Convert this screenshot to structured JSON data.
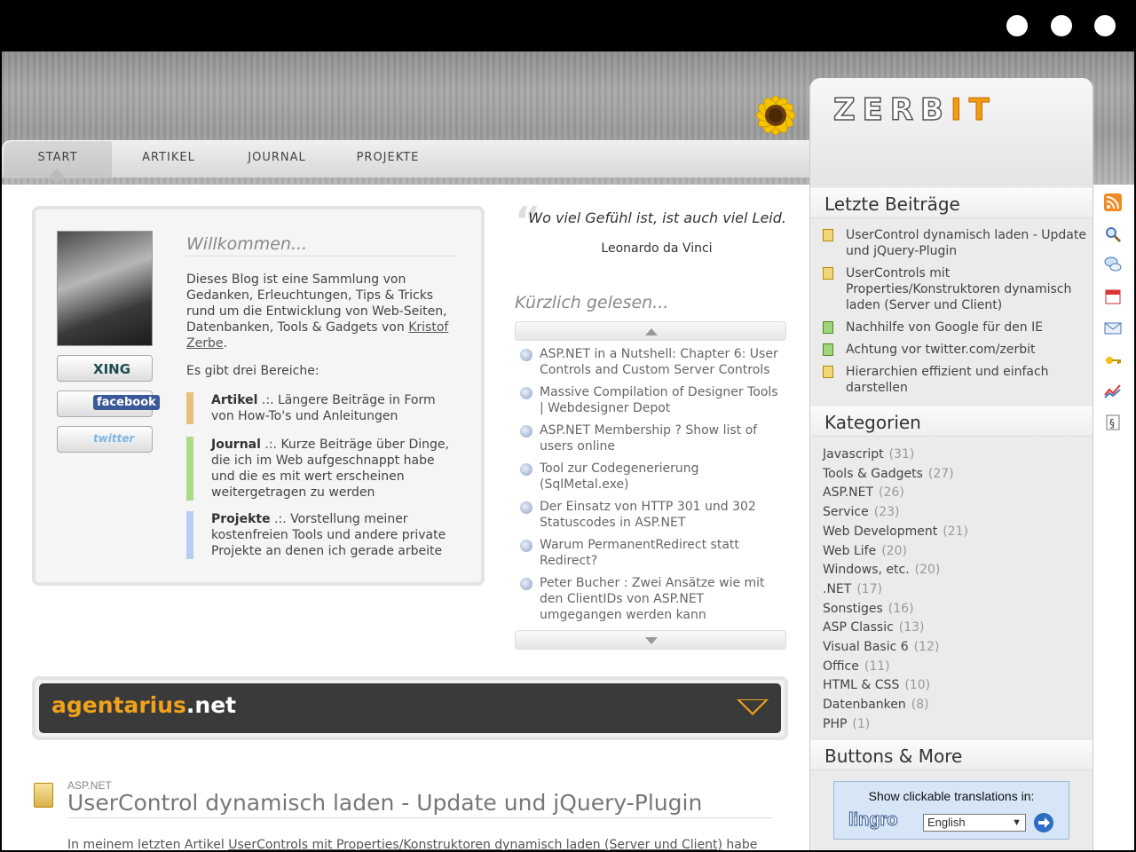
{
  "nav": {
    "items": [
      {
        "label": "Start",
        "active": true
      },
      {
        "label": "Artikel",
        "active": false
      },
      {
        "label": "Journal",
        "active": false
      },
      {
        "label": "Projekte",
        "active": false
      }
    ]
  },
  "logo": {
    "text": "ZERB",
    "accent": "IT"
  },
  "welcome": {
    "title": "Willkommen...",
    "intro_pre": "Dieses Blog ist eine Sammlung von Gedanken, Erleuchtungen, Tips & Tricks rund um die Entwicklung von Web-Seiten, Datenbanken, Tools & Gadgets von ",
    "intro_link": "Kristof Zerbe",
    "intro_post": ".",
    "areas_intro": "Es gibt drei Bereiche:",
    "areas": [
      {
        "name": "Artikel",
        "sep": " .:. ",
        "desc": "Längere Beiträge in Form von How-To's und Anleitungen",
        "color": "#e8c07a"
      },
      {
        "name": "Journal",
        "sep": " .:. ",
        "desc": "Kurze Beiträge über Dinge, die ich im Web aufgeschnappt habe und die es mit wert erscheinen weitergetragen zu werden",
        "color": "#a9dc84"
      },
      {
        "name": "Projekte",
        "sep": " .:. ",
        "desc": "Vorstellung meiner kostenfreien Tools und andere private Projekte an denen ich gerade arbeite",
        "color": "#b7cdf3"
      }
    ],
    "social": [
      "XING",
      "facebook",
      "twitter"
    ]
  },
  "quote": {
    "text": "Wo viel Gefühl ist, ist auch viel Leid.",
    "author": "Leonardo da Vinci"
  },
  "recently_read": {
    "title": "Kürzlich gelesen...",
    "items": [
      "ASP.NET in a Nutshell: Chapter 6: User Controls and Custom Server Controls",
      "Massive Compilation of Designer Tools | Webdesigner Depot",
      "ASP.NET Membership ? Show list of users online",
      "Tool zur Codegenerierung (SqlMetal.exe)",
      "Der Einsatz von HTTP 301 und 302 Statuscodes in ASP.NET",
      "Warum PermanentRedirect statt Redirect?",
      "Peter Bucher : Zwei Ansätze wie mit den ClientIDs von ASP.NET umgegangen werden kann"
    ]
  },
  "banner": {
    "brand": "agentarius",
    "tld": ".net"
  },
  "article": {
    "category": "ASP.NET",
    "title": "UserControl dynamisch laden - Update und jQuery-Plugin",
    "text_pre": "In meinem letzten Artikel ",
    "text_link": "UserControls mit Properties/Konstruktoren dynamisch laden (Server und Client)",
    "text_post": " habe"
  },
  "sidebar": {
    "recent_title": "Letzte Beiträge",
    "recent": [
      {
        "label": "UserControl dynamisch laden - Update und jQuery-Plugin",
        "icon": "article-icon"
      },
      {
        "label": "UserControls mit Properties/Konstruktoren dynamisch laden (Server und Client)",
        "icon": "article-icon"
      },
      {
        "label": "Nachhilfe von Google für den IE",
        "icon": "journal-icon"
      },
      {
        "label": "Achtung vor twitter.com/zerbit",
        "icon": "journal-icon"
      },
      {
        "label": "Hierarchien effizient und einfach darstellen",
        "icon": "article-icon"
      }
    ],
    "categories_title": "Kategorien",
    "categories": [
      {
        "name": "Javascript",
        "count": "(31)"
      },
      {
        "name": "Tools & Gadgets",
        "count": "(27)"
      },
      {
        "name": "ASP.NET",
        "count": "(26)"
      },
      {
        "name": "Service",
        "count": "(23)"
      },
      {
        "name": "Web Development",
        "count": "(21)"
      },
      {
        "name": "Web Life",
        "count": "(20)"
      },
      {
        "name": "Windows, etc.",
        "count": "(20)"
      },
      {
        "name": ".NET",
        "count": "(17)"
      },
      {
        "name": "Sonstiges",
        "count": "(16)"
      },
      {
        "name": "ASP Classic",
        "count": "(13)"
      },
      {
        "name": "Visual Basic 6",
        "count": "(12)"
      },
      {
        "name": "Office",
        "count": "(11)"
      },
      {
        "name": "HTML & CSS",
        "count": "(10)"
      },
      {
        "name": "Datenbanken",
        "count": "(8)"
      },
      {
        "name": "PHP",
        "count": "(1)"
      }
    ],
    "buttons_title": "Buttons & More",
    "translate": {
      "label": "Show clickable translations in:",
      "brand": "lingro",
      "selected": "English"
    }
  },
  "icon_strip": [
    "rss-icon",
    "search-icon",
    "comments-icon",
    "calendar-icon",
    "mail-icon",
    "login-icon",
    "stats-icon",
    "legal-icon"
  ],
  "colors": {
    "accent": "#f0a21b",
    "banner_bg": "#3a3a3a",
    "sidebar_bg": "#ebebeb"
  }
}
